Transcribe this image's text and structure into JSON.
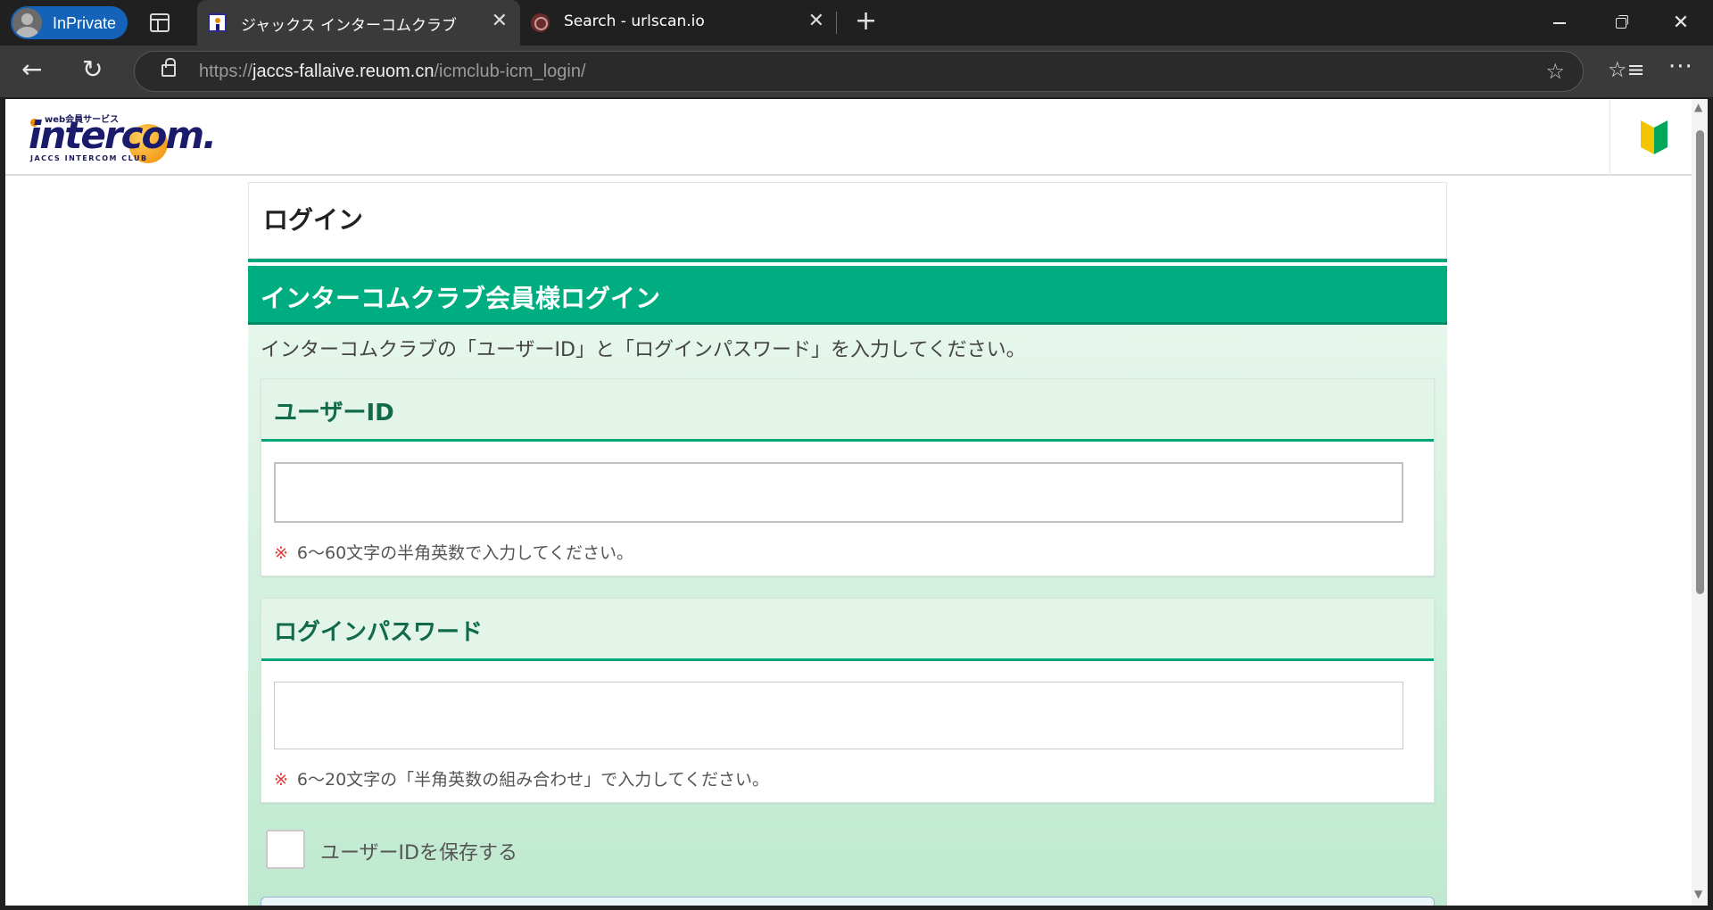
{
  "browser": {
    "profile_label": "InPrivate",
    "tabs": [
      {
        "title": "ジャックス インターコムクラブ",
        "active": true
      },
      {
        "title": "Search - urlscan.io",
        "active": false
      }
    ],
    "url": {
      "scheme": "https://",
      "host": "jaccs-fallaive.reuom.cn",
      "path": "/icmclub-icm_login/"
    },
    "icons": {
      "close": "✕",
      "new_tab": "+",
      "back": "←",
      "refresh": "↻",
      "star": "☆",
      "favorites": "☆≡",
      "menu": "···",
      "win_close": "✕"
    }
  },
  "site": {
    "logo": {
      "small": "web会員サービス",
      "big": "intercom.",
      "sub": "JACCS INTERCOM CLUB"
    },
    "page_title": "ログイン",
    "section_title": "インターコムクラブ会員様ログイン",
    "intro": "インターコムクラブの「ユーザーID」と「ログインパスワード」を入力してください。",
    "user_id": {
      "label": "ユーザーID",
      "value": "",
      "note_mark": "※",
      "note": "6〜60文字の半角英数で入力してください。"
    },
    "password": {
      "label": "ログインパスワード",
      "value": "",
      "note_mark": "※",
      "note": "6〜20文字の「半角英数の組み合わせ」で入力してください。"
    },
    "save_user_id": {
      "label": "ユーザーIDを保存する",
      "checked": false
    }
  },
  "colors": {
    "accent_green": "#00ad80",
    "label_green": "#116b4b",
    "note_red": "#e23a3a",
    "profile_blue": "#1463b8"
  }
}
